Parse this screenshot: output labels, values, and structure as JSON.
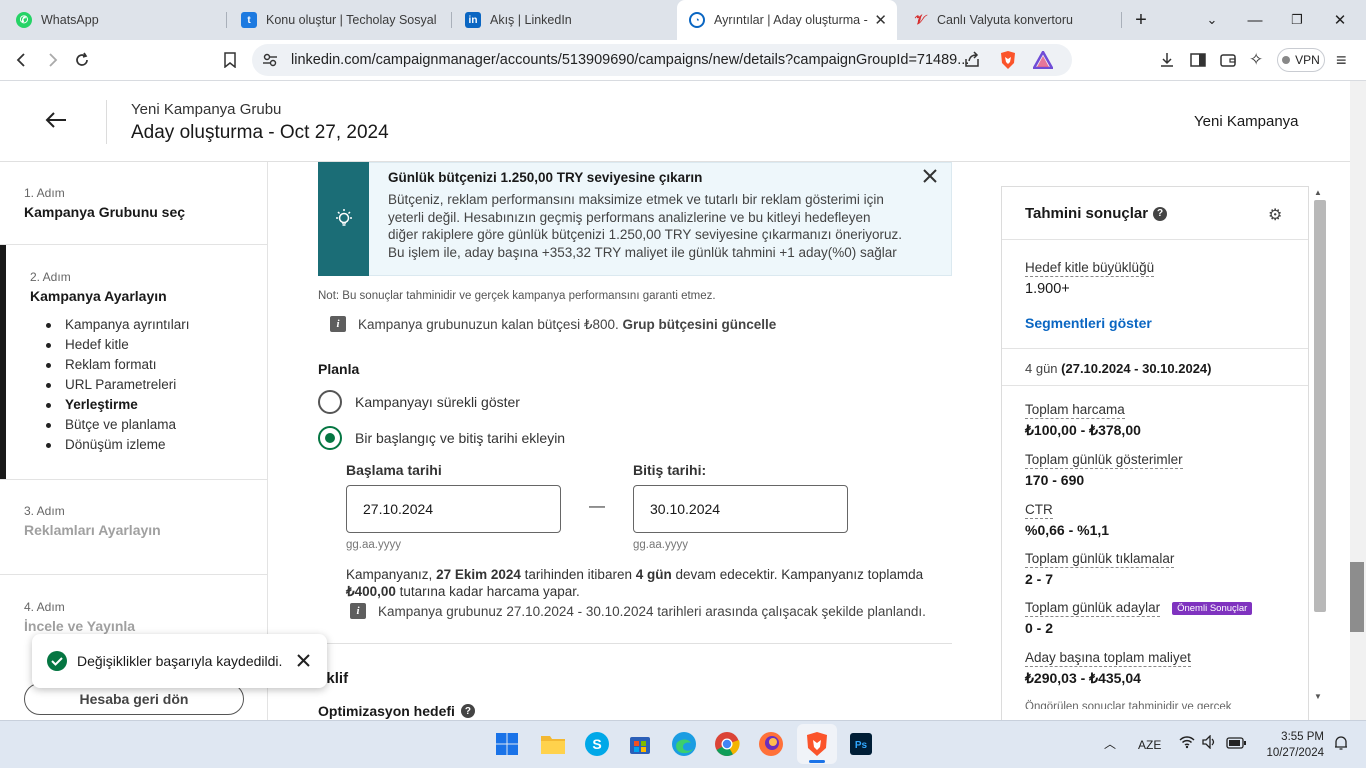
{
  "browser": {
    "tabs": [
      {
        "label": "WhatsApp"
      },
      {
        "label": "Konu oluştur | Techolay Sosyal"
      },
      {
        "label": "Akış | LinkedIn"
      },
      {
        "label": "Ayrıntılar | Aday oluşturma -"
      },
      {
        "label": "Canlı Valyuta konvertoru"
      }
    ],
    "url": "linkedin.com/campaignmanager/accounts/513909690/campaigns/new/details?campaignGroupId=71489...",
    "vpn_label": "VPN"
  },
  "header": {
    "group_label": "Yeni Kampanya Grubu",
    "title": "Aday oluşturma - Oct 27, 2024",
    "right_label": "Yeni Kampanya"
  },
  "sidebar": {
    "step1": {
      "num": "1. Adım",
      "title": "Kampanya Grubunu seç"
    },
    "step2": {
      "num": "2. Adım",
      "title": "Kampanya Ayarlayın",
      "items": [
        "Kampanya ayrıntıları",
        "Hedef kitle",
        "Reklam formatı",
        "URL Parametreleri",
        "Yerleştirme",
        "Bütçe ve planlama",
        "Dönüşüm izleme"
      ]
    },
    "step3": {
      "num": "3. Adım",
      "title": "Reklamları Ayarlayın"
    },
    "step4": {
      "num": "4. Adım",
      "title": "İncele ve Yayınla"
    },
    "back_button": "Hesaba geri dön"
  },
  "banner": {
    "title": "Günlük bütçenizi 1.250,00 TRY seviyesine çıkarın",
    "lines": [
      "Bütçeniz, reklam performansını maksimize etmek ve tutarlı bir reklam gösterimi için",
      "yeterli değil. Hesabınızın geçmiş performans analizlerine ve bu kitleyi hedefleyen",
      "diğer rakiplere göre günlük bütçenizi 1.250,00 TRY seviyesine çıkarmanızı öneriyoruz.",
      "Bu işlem ile, aday başına +353,32 TRY maliyet ile günlük tahmini +1 aday(%0) sağlar"
    ]
  },
  "note": "Not: Bu sonuçlar tahminidir ve gerçek kampanya performansını garanti etmez.",
  "remaining": {
    "text": "Kampanya grubunuzun kalan bütçesi ₺800. ",
    "link": "Grup bütçesini güncelle"
  },
  "schedule": {
    "heading": "Planla",
    "option1": "Kampanyayı sürekli göster",
    "option2": "Bir başlangıç ve bitiş tarihi ekleyin",
    "start_label": "Başlama tarihi",
    "end_label": "Bitiş tarihi:",
    "start_value": "27.10.2024",
    "end_value": "30.10.2024",
    "date_hint": "gg.aa.yyyy",
    "dash": "—",
    "summary_parts": [
      "Kampanyanız, ",
      "27 Ekim 2024",
      " tarihinden itibaren ",
      "4 gün",
      " devam edecektir. Kampanyanız toplamda"
    ],
    "summary_line2_bold": "₺400,00",
    "summary_line2_rest": " tutarına kadar harcama yapar.",
    "info": "Kampanya grubunuz 27.10.2024 - 30.10.2024 tarihleri arasında çalışacak şekilde planlandı."
  },
  "bid": {
    "heading": "Teklif",
    "opt_label": "Optimizasyon hedefi"
  },
  "toast": {
    "text": "Değişiklikler başarıyla kaydedildi."
  },
  "results": {
    "title": "Tahmini sonuçlar",
    "audience_label": "Hedef kitle büyüklüğü",
    "audience_value": "1.900+",
    "segments_link": "Segmentleri göster",
    "days": "4 gün ",
    "days_range": "(27.10.2024 - 30.10.2024)",
    "metrics": [
      {
        "label": "Toplam harcama",
        "value": "₺100,00 - ₺378,00"
      },
      {
        "label": "Toplam günlük gösterimler",
        "value": "170 - 690"
      },
      {
        "label": "CTR",
        "value": "%0,66 - %1,1"
      },
      {
        "label": "Toplam günlük tıklamalar",
        "value": "2 - 7"
      },
      {
        "label": "Toplam günlük adaylar",
        "value": "0 - 2",
        "badge": "Önemli Sonuçlar"
      },
      {
        "label": "Aday başına toplam maliyet",
        "value": "₺290,03 - ₺435,04"
      }
    ],
    "footer": "Öngörülen sonuçlar tahminidir ve gerçek"
  },
  "taskbar": {
    "lang": "AZE",
    "time": "3:55 PM",
    "date": "10/27/2024"
  },
  "colors": {
    "accent_blue": "#0a66c2",
    "banner_teal": "#1b6d76",
    "success_green": "#057642",
    "badge_purple": "#7f33bf"
  }
}
